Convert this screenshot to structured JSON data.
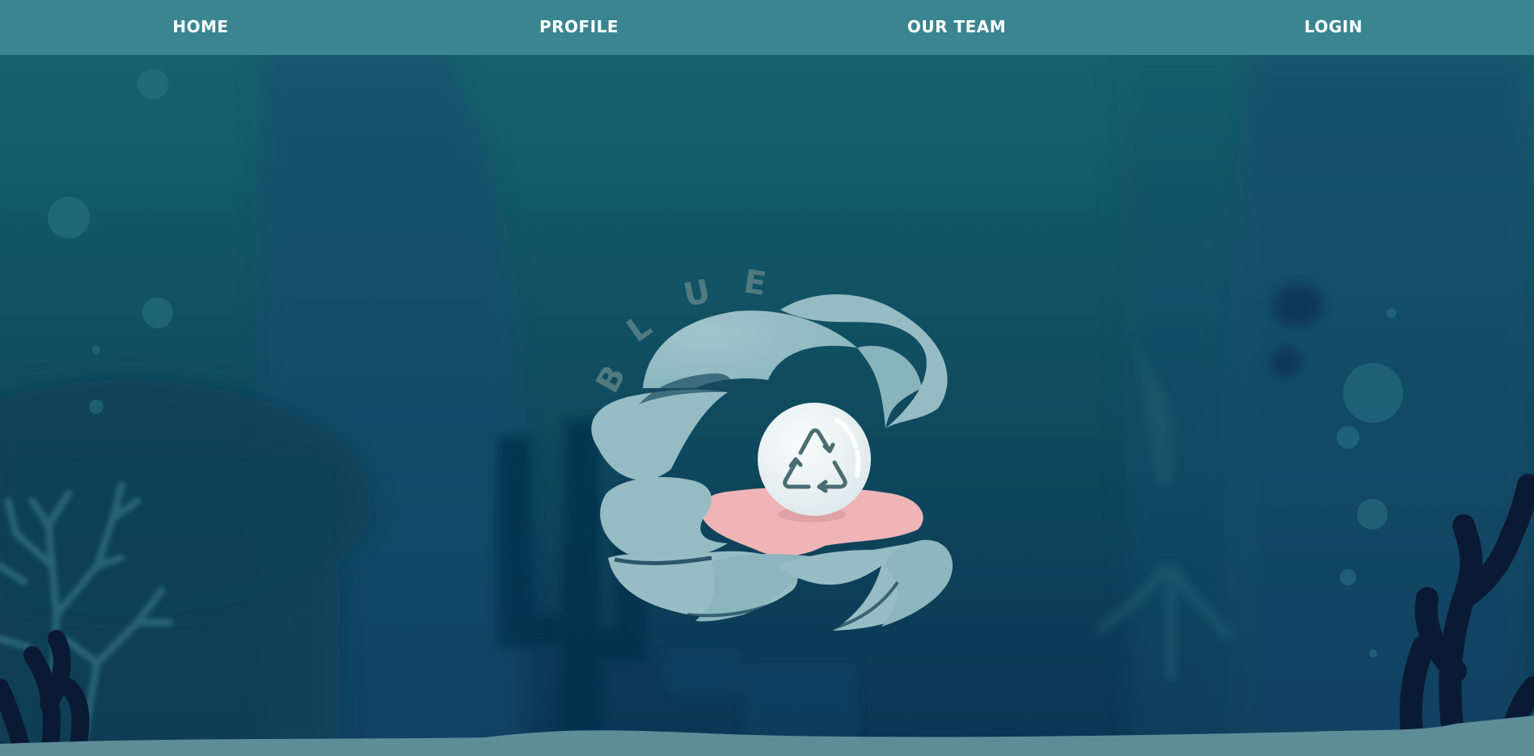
{
  "nav": {
    "items": [
      {
        "label": "HOME"
      },
      {
        "label": "PROFILE"
      },
      {
        "label": "OUR TEAM"
      },
      {
        "label": "LOGIN"
      }
    ]
  },
  "logo": {
    "arc_text": "BLUE",
    "icon": "recycle-icon"
  },
  "colors": {
    "navbar": "#3b8590",
    "water_top": "#17606f",
    "water_bottom": "#0c3a57",
    "shell": "#94bcc3",
    "pearl": "#eef5f6",
    "tongue": "#efb3b5",
    "recycle_stroke": "#4a6d72",
    "coral_dark": "#0b1a34"
  }
}
